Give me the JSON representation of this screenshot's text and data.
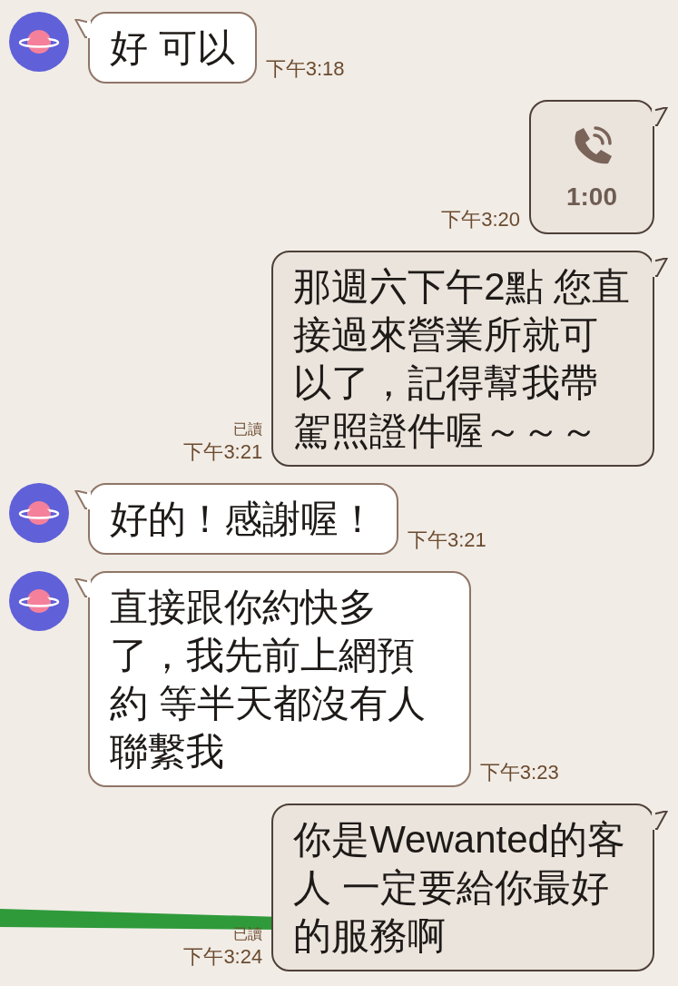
{
  "messages": [
    {
      "kind": "incoming_text",
      "text": "好 可以",
      "time": "下午3:18"
    },
    {
      "kind": "outgoing_call",
      "duration": "1:00",
      "time": "下午3:20"
    },
    {
      "kind": "outgoing_text",
      "read_label": "已讀",
      "text": "那週六下午2點 您直接過來營業所就可以了，記得幫我帶駕照證件喔～～～",
      "time": "下午3:21"
    },
    {
      "kind": "incoming_text",
      "text": "好的！感謝喔！",
      "time": "下午3:21"
    },
    {
      "kind": "incoming_text",
      "text": "直接跟你約快多了，我先前上網預約 等半天都沒有人聯繫我",
      "time": "下午3:23"
    },
    {
      "kind": "outgoing_text",
      "read_label": "已讀",
      "text": "你是Wewanted的客人 一定要給你最好的服務啊",
      "time": "下午3:24"
    }
  ]
}
